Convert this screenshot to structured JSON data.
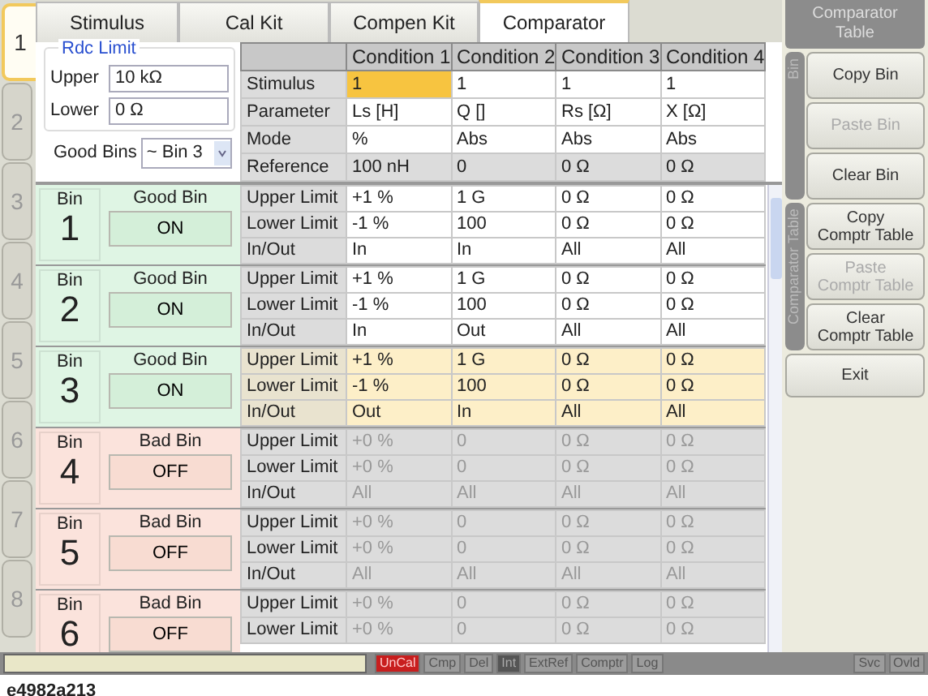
{
  "side_tabs": [
    {
      "label": "1",
      "selected": true
    },
    {
      "label": "2",
      "selected": false
    },
    {
      "label": "3",
      "selected": false
    },
    {
      "label": "4",
      "selected": false
    },
    {
      "label": "5",
      "selected": false
    },
    {
      "label": "6",
      "selected": false
    },
    {
      "label": "7",
      "selected": false
    },
    {
      "label": "8",
      "selected": false
    }
  ],
  "tabs": [
    {
      "label": "Stimulus",
      "selected": false
    },
    {
      "label": "Cal Kit",
      "selected": false
    },
    {
      "label": "Compen Kit",
      "selected": false
    },
    {
      "label": "Comparator",
      "selected": true
    }
  ],
  "rdc_limit": {
    "title": "Rdc Limit",
    "upper_label": "Upper",
    "upper_value": "10 kΩ",
    "lower_label": "Lower",
    "lower_value": "0 Ω"
  },
  "good_bins": {
    "label": "Good Bins",
    "value": "~ Bin 3"
  },
  "conditions": {
    "columns": [
      "Condition 1",
      "Condition 2",
      "Condition 3",
      "Condition 4"
    ],
    "rows": [
      {
        "label": "Stimulus",
        "kind": "setting",
        "cells": [
          {
            "text": "1",
            "selected": true
          },
          {
            "text": "1",
            "selected": false
          },
          {
            "text": "1",
            "selected": false
          },
          {
            "text": "1",
            "selected": false
          }
        ]
      },
      {
        "label": "Parameter",
        "kind": "setting",
        "cells": [
          {
            "text": "Ls [H]",
            "selected": false
          },
          {
            "text": "Q []",
            "selected": false
          },
          {
            "text": "Rs [Ω]",
            "selected": false
          },
          {
            "text": "X [Ω]",
            "selected": false
          }
        ]
      },
      {
        "label": "Mode",
        "kind": "setting",
        "cells": [
          {
            "text": "%",
            "selected": false
          },
          {
            "text": "Abs",
            "selected": false
          },
          {
            "text": "Abs",
            "selected": false
          },
          {
            "text": "Abs",
            "selected": false
          }
        ]
      },
      {
        "label": "Reference",
        "kind": "readonly",
        "cells": [
          {
            "text": "100 nH",
            "selected": false
          },
          {
            "text": "0",
            "selected": false
          },
          {
            "text": "0 Ω",
            "selected": false
          },
          {
            "text": "0 Ω",
            "selected": false
          }
        ]
      }
    ]
  },
  "bins": [
    {
      "bin_label": "Bin",
      "number": "1",
      "kind": "good",
      "type": "Good Bin",
      "state": "ON",
      "selected": false,
      "disabled": false,
      "rows": [
        {
          "label": "Upper Limit",
          "values": [
            "+1 %",
            "1 G",
            "0 Ω",
            "0 Ω"
          ]
        },
        {
          "label": "Lower Limit",
          "values": [
            "-1 %",
            "100",
            "0 Ω",
            "0 Ω"
          ]
        },
        {
          "label": "In/Out",
          "values": [
            "In",
            "In",
            "All",
            "All"
          ]
        }
      ]
    },
    {
      "bin_label": "Bin",
      "number": "2",
      "kind": "good",
      "type": "Good Bin",
      "state": "ON",
      "selected": false,
      "disabled": false,
      "rows": [
        {
          "label": "Upper Limit",
          "values": [
            "+1 %",
            "1 G",
            "0 Ω",
            "0 Ω"
          ]
        },
        {
          "label": "Lower Limit",
          "values": [
            "-1 %",
            "100",
            "0 Ω",
            "0 Ω"
          ]
        },
        {
          "label": "In/Out",
          "values": [
            "In",
            "Out",
            "All",
            "All"
          ]
        }
      ]
    },
    {
      "bin_label": "Bin",
      "number": "3",
      "kind": "good",
      "type": "Good Bin",
      "state": "ON",
      "selected": true,
      "disabled": false,
      "rows": [
        {
          "label": "Upper Limit",
          "values": [
            "+1 %",
            "1 G",
            "0 Ω",
            "0 Ω"
          ]
        },
        {
          "label": "Lower Limit",
          "values": [
            "-1 %",
            "100",
            "0 Ω",
            "0 Ω"
          ]
        },
        {
          "label": "In/Out",
          "values": [
            "Out",
            "In",
            "All",
            "All"
          ]
        }
      ]
    },
    {
      "bin_label": "Bin",
      "number": "4",
      "kind": "bad",
      "type": "Bad Bin",
      "state": "OFF",
      "selected": false,
      "disabled": true,
      "rows": [
        {
          "label": "Upper Limit",
          "values": [
            "+0 %",
            "0",
            "0 Ω",
            "0 Ω"
          ]
        },
        {
          "label": "Lower Limit",
          "values": [
            "+0 %",
            "0",
            "0 Ω",
            "0 Ω"
          ]
        },
        {
          "label": "In/Out",
          "values": [
            "All",
            "All",
            "All",
            "All"
          ]
        }
      ]
    },
    {
      "bin_label": "Bin",
      "number": "5",
      "kind": "bad",
      "type": "Bad Bin",
      "state": "OFF",
      "selected": false,
      "disabled": true,
      "rows": [
        {
          "label": "Upper Limit",
          "values": [
            "+0 %",
            "0",
            "0 Ω",
            "0 Ω"
          ]
        },
        {
          "label": "Lower Limit",
          "values": [
            "+0 %",
            "0",
            "0 Ω",
            "0 Ω"
          ]
        },
        {
          "label": "In/Out",
          "values": [
            "All",
            "All",
            "All",
            "All"
          ]
        }
      ]
    },
    {
      "bin_label": "Bin",
      "number": "6",
      "kind": "bad",
      "type": "Bad Bin",
      "state": "OFF",
      "selected": false,
      "disabled": true,
      "rows": [
        {
          "label": "Upper Limit",
          "values": [
            "+0 %",
            "0",
            "0 Ω",
            "0 Ω"
          ]
        },
        {
          "label": "Lower Limit",
          "values": [
            "+0 %",
            "0",
            "0 Ω",
            "0 Ω"
          ]
        }
      ]
    }
  ],
  "menu": {
    "title": "Comparator Table",
    "groups": [
      {
        "label": "Bin",
        "buttons": [
          {
            "label": "Copy Bin",
            "disabled": false
          },
          {
            "label": "Paste Bin",
            "disabled": true
          },
          {
            "label": "Clear Bin",
            "disabled": false
          }
        ]
      },
      {
        "label": "Comparator Table",
        "buttons": [
          {
            "label": "Copy\nComptr Table",
            "disabled": false
          },
          {
            "label": "Paste\nComptr Table",
            "disabled": true
          },
          {
            "label": "Clear\nComptr Table",
            "disabled": false
          }
        ]
      }
    ],
    "exit": "Exit"
  },
  "status_bar": {
    "left": [
      {
        "label": "UnCal",
        "kind": "alert"
      },
      {
        "label": "Cmp",
        "kind": "inactive"
      },
      {
        "label": "Del",
        "kind": "inactive"
      },
      {
        "label": "Int",
        "kind": "active"
      },
      {
        "label": "ExtRef",
        "kind": "inactive"
      },
      {
        "label": "Comptr",
        "kind": "inactive"
      },
      {
        "label": "Log",
        "kind": "inactive"
      }
    ],
    "right": [
      {
        "label": "Svc",
        "kind": "inactive"
      },
      {
        "label": "Ovld",
        "kind": "inactive"
      }
    ]
  },
  "caption": "e4982a213"
}
